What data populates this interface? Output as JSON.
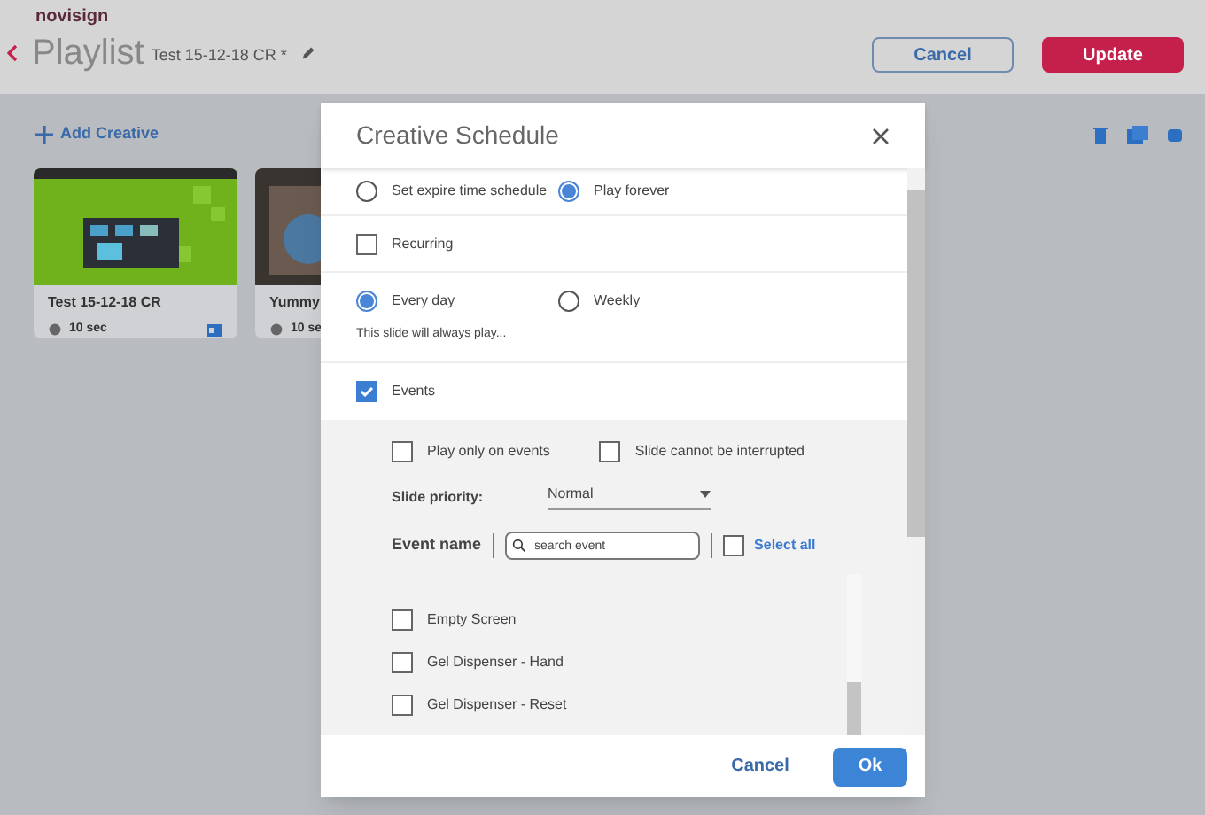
{
  "header": {
    "brand": "novisign",
    "title": "Playlist",
    "playlist_name": "Test 15-12-18 CR *",
    "buttons": [
      {
        "label": "Cancel",
        "kind": "outline"
      },
      {
        "label": "Update",
        "kind": "primary"
      }
    ]
  },
  "toolbar": {
    "add_label": "Add Creative"
  },
  "creatives": [
    {
      "title": "Test 15-12-18 CR",
      "duration": "10 sec",
      "kind": "green"
    },
    {
      "title": "Yummy",
      "duration": "10 se",
      "kind": "dark"
    }
  ],
  "dialog": {
    "title": "Creative Schedule",
    "expiry": [
      {
        "label": "Set expire time schedule",
        "selected": false
      },
      {
        "label": "Play forever",
        "selected": true
      }
    ],
    "recurring": {
      "label": "Recurring",
      "checked": false
    },
    "frequency": [
      {
        "label": "Every day",
        "selected": true
      },
      {
        "label": "Weekly",
        "selected": false
      }
    ],
    "note": "This slide will always play...",
    "events": {
      "label": "Events",
      "checked": true
    },
    "options": [
      {
        "label": "Play only on events",
        "checked": false
      },
      {
        "label": "Slide cannot be interrupted",
        "checked": false
      }
    ],
    "priority": {
      "label": "Slide priority:",
      "value": "Normal"
    },
    "event_name_label": "Event name",
    "search": {
      "placeholder": "search event"
    },
    "select_all": {
      "label": "Select all",
      "checked": false
    },
    "event_list": [
      {
        "label": "Empty Screen",
        "checked": false
      },
      {
        "label": "Gel Dispenser - Hand",
        "checked": false
      },
      {
        "label": "Gel Dispenser - Reset",
        "checked": false
      }
    ],
    "buttons": [
      {
        "label": "Cancel",
        "kind": "text"
      },
      {
        "label": "Ok",
        "kind": "primary"
      }
    ]
  }
}
